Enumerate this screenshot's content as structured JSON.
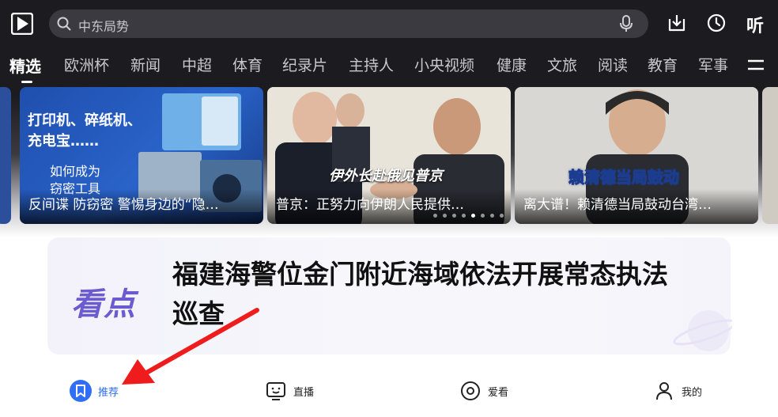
{
  "header": {
    "logo_icon": "play-logo-icon",
    "search": {
      "value": "中东局势",
      "icon": "search-icon"
    },
    "mic_icon": "microphone-icon",
    "download_icon": "download-icon",
    "history_icon": "clock-icon",
    "listen_label": "听"
  },
  "tabs": [
    {
      "label": "精选",
      "active": true
    },
    {
      "label": "欧洲杯"
    },
    {
      "label": "新闻"
    },
    {
      "label": "中超"
    },
    {
      "label": "体育"
    },
    {
      "label": "纪录片"
    },
    {
      "label": "主持人"
    },
    {
      "label": "小央视频"
    },
    {
      "label": "健康"
    },
    {
      "label": "文旅"
    },
    {
      "label": "阅读"
    },
    {
      "label": "教育"
    },
    {
      "label": "军事"
    }
  ],
  "carousel": {
    "cards": [
      {
        "caption": "反间谍 防窃密 警惕身边的“隐…",
        "overlay_lines": [
          "打印机、碎纸机、",
          "充电宝……",
          "如何成为",
          "窃密工具"
        ]
      },
      {
        "caption": "普京：正努力向伊朗人民提供…",
        "overlay_lines": [
          "伊外长赴俄见普京"
        ]
      },
      {
        "caption": "离大谱！赖清德当局鼓动台湾…",
        "overlay_lines": [
          "赖清德当局鼓动"
        ]
      }
    ],
    "dot_count": 8,
    "active_dot": 5
  },
  "headline": {
    "badge": "看点",
    "title": "福建海警位金门附近海域依法开展常态执法巡查"
  },
  "bottom_nav": [
    {
      "label": "推荐",
      "icon": "bookmark-icon",
      "active": true
    },
    {
      "label": "直播",
      "icon": "tv-icon"
    },
    {
      "label": "爱看",
      "icon": "disc-icon"
    },
    {
      "label": "我的",
      "icon": "user-icon"
    }
  ],
  "colors": {
    "accent": "#2f6ff5",
    "arrow": "#ee1c1c",
    "badge": "#6b5bd0"
  }
}
